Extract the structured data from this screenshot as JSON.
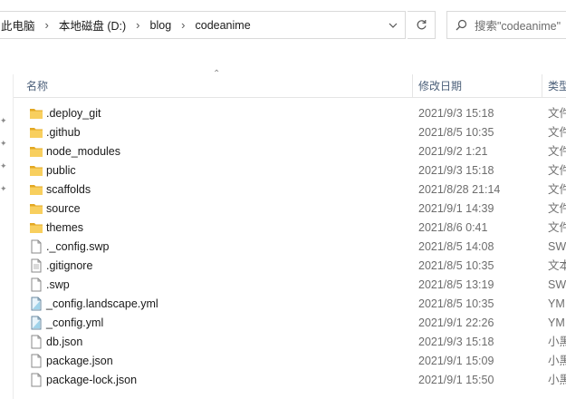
{
  "address_bar": {
    "crumbs": [
      "此电脑",
      "本地磁盘 (D:)",
      "blog",
      "codeanime"
    ]
  },
  "search": {
    "placeholder": "搜索\"codeanime\""
  },
  "columns": {
    "name": "名称",
    "date": "修改日期",
    "type": "类型"
  },
  "files": [
    {
      "name": ".deploy_git",
      "date": "2021/9/3 15:18",
      "type": "文件",
      "icon": "folder-icon"
    },
    {
      "name": ".github",
      "date": "2021/8/5 10:35",
      "type": "文件",
      "icon": "folder-icon"
    },
    {
      "name": "node_modules",
      "date": "2021/9/2 1:21",
      "type": "文件",
      "icon": "folder-icon"
    },
    {
      "name": "public",
      "date": "2021/9/3 15:18",
      "type": "文件",
      "icon": "folder-icon"
    },
    {
      "name": "scaffolds",
      "date": "2021/8/28 21:14",
      "type": "文件",
      "icon": "folder-icon"
    },
    {
      "name": "source",
      "date": "2021/9/1 14:39",
      "type": "文件",
      "icon": "folder-icon"
    },
    {
      "name": "themes",
      "date": "2021/8/6 0:41",
      "type": "文件",
      "icon": "folder-icon"
    },
    {
      "name": "._config.swp",
      "date": "2021/8/5 14:08",
      "type": "SW",
      "icon": "file-icon"
    },
    {
      "name": ".gitignore",
      "date": "2021/8/5 10:35",
      "type": "文本",
      "icon": "text-file-icon"
    },
    {
      "name": ".swp",
      "date": "2021/8/5 13:19",
      "type": "SW",
      "icon": "file-icon"
    },
    {
      "name": "_config.landscape.yml",
      "date": "2021/8/5 10:35",
      "type": "YM",
      "icon": "yml-file-icon"
    },
    {
      "name": "_config.yml",
      "date": "2021/9/1 22:26",
      "type": "YM",
      "icon": "yml-file-icon"
    },
    {
      "name": "db.json",
      "date": "2021/9/3 15:18",
      "type": "小黑",
      "icon": "file-icon"
    },
    {
      "name": "package.json",
      "date": "2021/9/1 15:09",
      "type": "小黑",
      "icon": "file-icon"
    },
    {
      "name": "package-lock.json",
      "date": "2021/9/1 15:50",
      "type": "小黑",
      "icon": "file-icon"
    }
  ],
  "colors": {
    "folder": "#f5c85a",
    "folder_dark": "#e3a823",
    "header_text": "#4c607a"
  }
}
